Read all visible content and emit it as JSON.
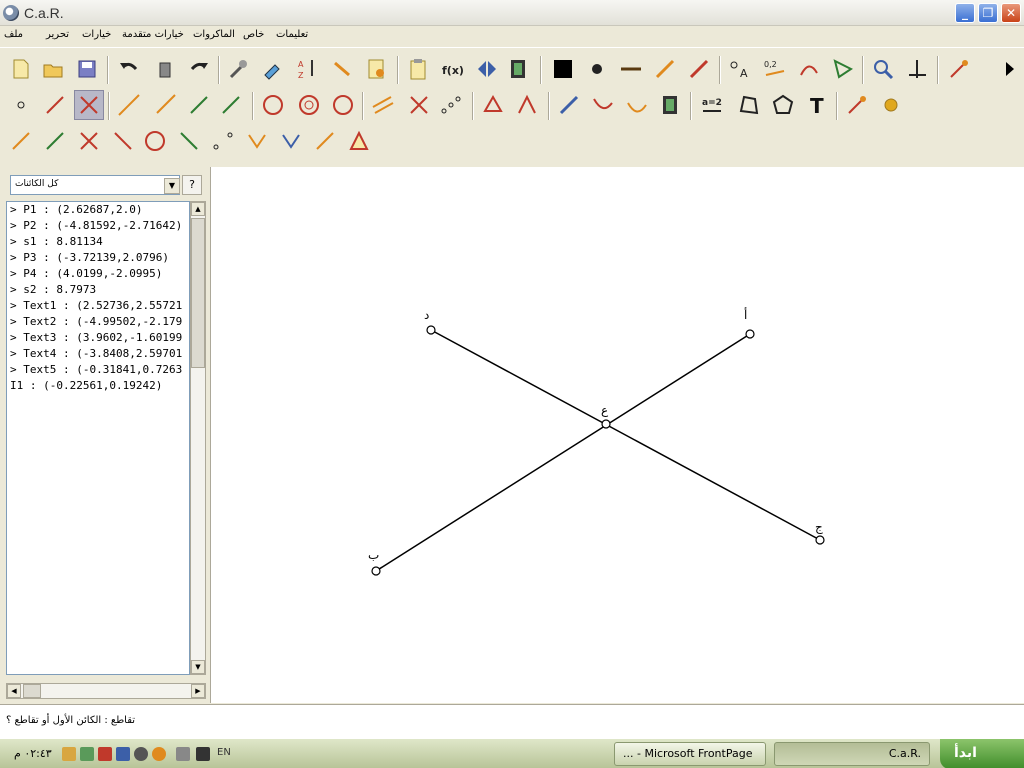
{
  "window": {
    "title": "C.a.R.",
    "minimize": "_",
    "restore": "❐",
    "close": "✕"
  },
  "menu": [
    "ملف",
    "تحرير",
    "خيارات",
    "خيارات متقدمة",
    "الماكروات",
    "خاص",
    "تعليمات"
  ],
  "panel": {
    "filter": "كل الكائنات",
    "help": "?",
    "objects": [
      "> P1 : (2.62687,2.0)",
      "> P2 : (-4.81592,-2.71642)",
      "> s1 : 8.81134",
      "> P3 : (-3.72139,2.0796)",
      "> P4 : (4.0199,-2.0995)",
      "> s2 : 8.7973",
      "> Text1 : (2.52736,2.55721",
      "> Text2 : (-4.99502,-2.179",
      "> Text3 : (3.9602,-1.60199",
      "> Text4 : (-3.8408,2.59701",
      "> Text5 : (-0.31841,0.7263",
      "I1 : (-0.22561,0.19242)"
    ]
  },
  "canvas": {
    "labels": {
      "p1": "أ",
      "p2": "ب",
      "p3": "د",
      "p4": "ج",
      "i1": "ع"
    }
  },
  "status": "تقاطع : الكائن الأول أو تقاطع ؟",
  "taskbar": {
    "time": "٠٢:٤٣ م",
    "lang": "EN",
    "tasks": [
      "... - Microsoft FrontPage",
      "C.a.R."
    ],
    "start": "ابدأ"
  },
  "colors": {
    "accent": "#316ac5",
    "tool_red": "#c0392b",
    "tool_orange": "#e08a1e",
    "tool_green": "#2e7d32"
  }
}
